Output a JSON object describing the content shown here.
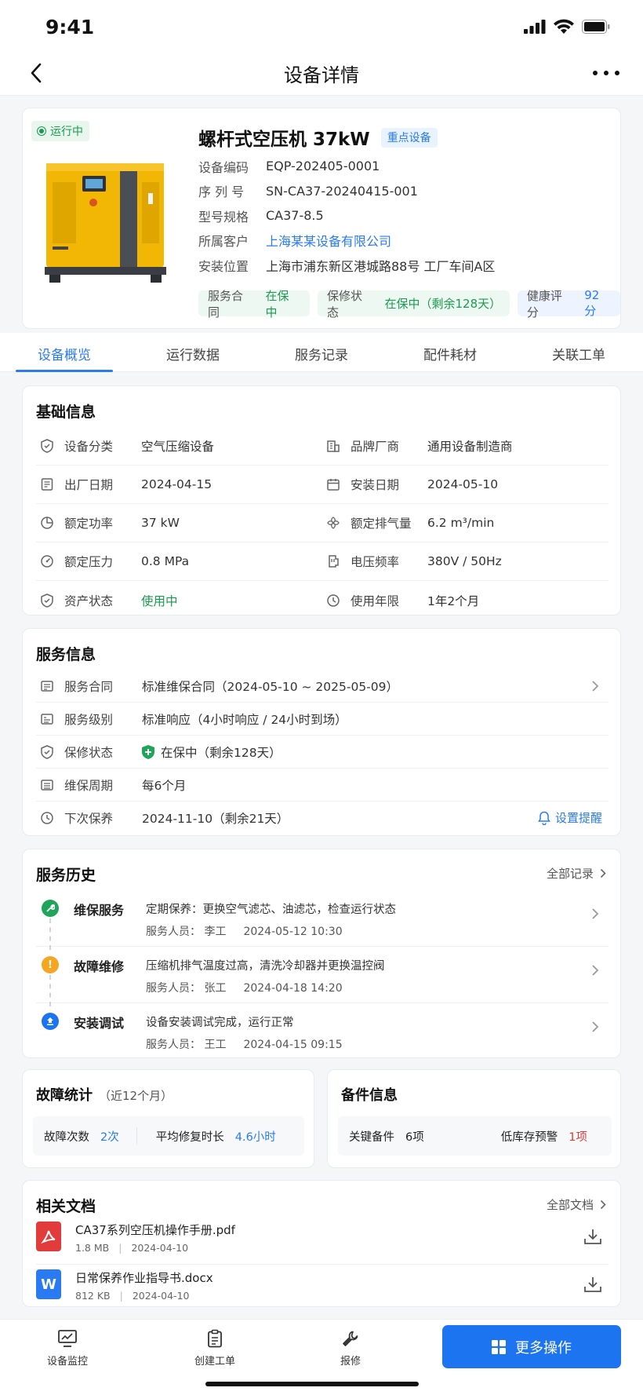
{
  "status_bar": {
    "time": "9:41"
  },
  "nav": {
    "title": "设备详情"
  },
  "device": {
    "status": "运行中",
    "name": "螺杆式空压机 37kW",
    "badge": "重点设备",
    "fields": [
      {
        "label": "设备编码",
        "value": "EQP-202405-0001"
      },
      {
        "label": "序 列 号",
        "value": "SN-CA37-20240415-001"
      },
      {
        "label": "型号规格",
        "value": "CA37-8.5"
      },
      {
        "label": "所属客户",
        "value": "上海某某设备有限公司",
        "link": true
      },
      {
        "label": "安装位置",
        "value": "上海市浦东新区港城路88号 工厂车间A区"
      }
    ],
    "pills": [
      {
        "label": "服务合同",
        "value": "在保中"
      },
      {
        "label": "保修状态",
        "value": "在保中（剩余128天）"
      },
      {
        "label": "健康评分",
        "value": "92分"
      }
    ]
  },
  "tabs": [
    "设备概览",
    "运行数据",
    "服务记录",
    "配件耗材",
    "关联工单"
  ],
  "basic": {
    "title": "基础信息",
    "rows": [
      [
        {
          "label": "设备分类",
          "value": "空气压缩设备",
          "icon": "category-icon"
        },
        {
          "label": "品牌厂商",
          "value": "通用设备制造商",
          "icon": "building-icon"
        }
      ],
      [
        {
          "label": "出厂日期",
          "value": "2024-04-15",
          "icon": "document-icon"
        },
        {
          "label": "安装日期",
          "value": "2024-05-10",
          "icon": "calendar-icon"
        }
      ],
      [
        {
          "label": "额定功率",
          "value": "37 kW",
          "icon": "pie-icon"
        },
        {
          "label": "额定排气量",
          "value": "6.2 m³/min",
          "icon": "fan-icon"
        }
      ],
      [
        {
          "label": "额定压力",
          "value": "0.8 MPa",
          "icon": "gauge-icon"
        },
        {
          "label": "电压频率",
          "value": "380V / 50Hz",
          "icon": "plug-icon"
        }
      ],
      [
        {
          "label": "资产状态",
          "value": "使用中",
          "icon": "shield-icon"
        },
        {
          "label": "使用年限",
          "value": "1年2个月",
          "icon": "clock-icon"
        }
      ]
    ]
  },
  "service": {
    "title": "服务信息",
    "rows": [
      {
        "label": "服务合同",
        "value": "标准维保合同（2024-05-10 ~ 2025-05-09）"
      },
      {
        "label": "服务级别",
        "value": "标准响应（4小时响应 / 24小时到场）"
      },
      {
        "label": "保修状态",
        "value": "在保中（剩余128天）"
      },
      {
        "label": "维保周期",
        "value": "每6个月"
      },
      {
        "label": "下次保养",
        "value": "2024-11-10（剩余21天）"
      }
    ],
    "remind": "设置提醒"
  },
  "history": {
    "title": "服务历史",
    "more": "全部记录",
    "items": [
      {
        "type": "维保服务",
        "desc": "定期保养：更换空气滤芯、油滤芯，检查运行状态",
        "person": "服务人员： 李工",
        "time": "2024-05-12 10:30",
        "color": "#1ea55a"
      },
      {
        "type": "故障维修",
        "desc": "压缩机排气温度过高，清洗冷却器并更换温控阀",
        "person": "服务人员： 张工",
        "time": "2024-04-18 14:20",
        "color": "#f5a623"
      },
      {
        "type": "安装调试",
        "desc": "设备安装调试完成，运行正常",
        "person": "服务人员： 王工",
        "time": "2024-04-15 09:15",
        "color": "#1d74f1"
      }
    ]
  },
  "fault": {
    "title": "故障统计",
    "sub": "（近12个月）",
    "count_label": "故障次数",
    "count": "2次",
    "mttr_label": "平均修复时长",
    "mttr": "4.6小时"
  },
  "spare": {
    "title": "备件信息",
    "key_label": "关键备件",
    "key": "6项",
    "low_label": "低库存预警",
    "low": "1项"
  },
  "docs": {
    "title": "相关文档",
    "more": "全部文档",
    "items": [
      {
        "name": "CA37系列空压机操作手册.pdf",
        "size": "1.8 MB",
        "date": "2024-04-10",
        "icon": "W"
      },
      {
        "name": "日常保养作业指导书.docx",
        "size": "812 KB",
        "date": "2024-04-10",
        "icon": "W"
      }
    ]
  },
  "bottom": {
    "monitor": "设备监控",
    "create": "创建工单",
    "repair": "报修",
    "more": "更多操作"
  }
}
